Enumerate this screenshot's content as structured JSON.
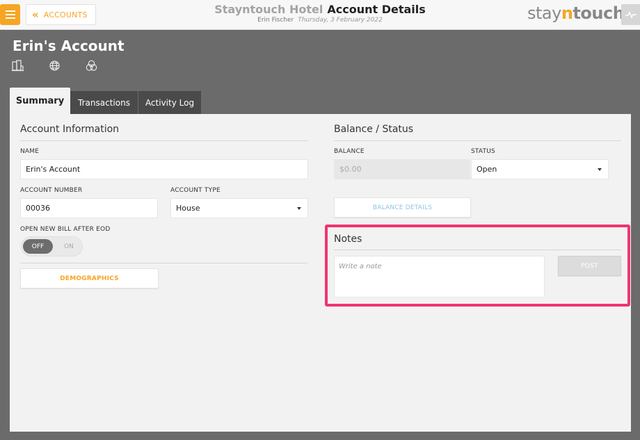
{
  "header": {
    "back_label": "ACCOUNTS",
    "hotel_name": "Stayntouch Hotel",
    "page_title": "Account Details",
    "user_name": "Erin Fischer",
    "date": "Thursday, 3 February 2022",
    "logo": {
      "part1": "stay",
      "part2": "n",
      "part3": "touch"
    }
  },
  "account": {
    "title": "Erin's Account"
  },
  "tabs": [
    {
      "label": "Summary",
      "active": true
    },
    {
      "label": "Transactions",
      "active": false
    },
    {
      "label": "Activity Log",
      "active": false
    }
  ],
  "account_info": {
    "section_title": "Account Information",
    "name_label": "NAME",
    "name_value": "Erin's Account",
    "number_label": "ACCOUNT NUMBER",
    "number_value": "00036",
    "type_label": "ACCOUNT TYPE",
    "type_value": "House",
    "bill_label": "OPEN NEW BILL AFTER EOD",
    "toggle_off": "OFF",
    "toggle_on": "ON",
    "demographics_button": "DEMOGRAPHICS"
  },
  "balance_status": {
    "section_title": "Balance / Status",
    "balance_label": "BALANCE",
    "balance_value": "$0.00",
    "status_label": "STATUS",
    "status_value": "Open",
    "details_button": "BALANCE DETAILS"
  },
  "notes": {
    "section_title": "Notes",
    "placeholder": "Write a note",
    "post_button": "POST"
  },
  "colors": {
    "accent": "#f5a623",
    "highlight": "#f0346f",
    "link": "#8cc6e0"
  }
}
